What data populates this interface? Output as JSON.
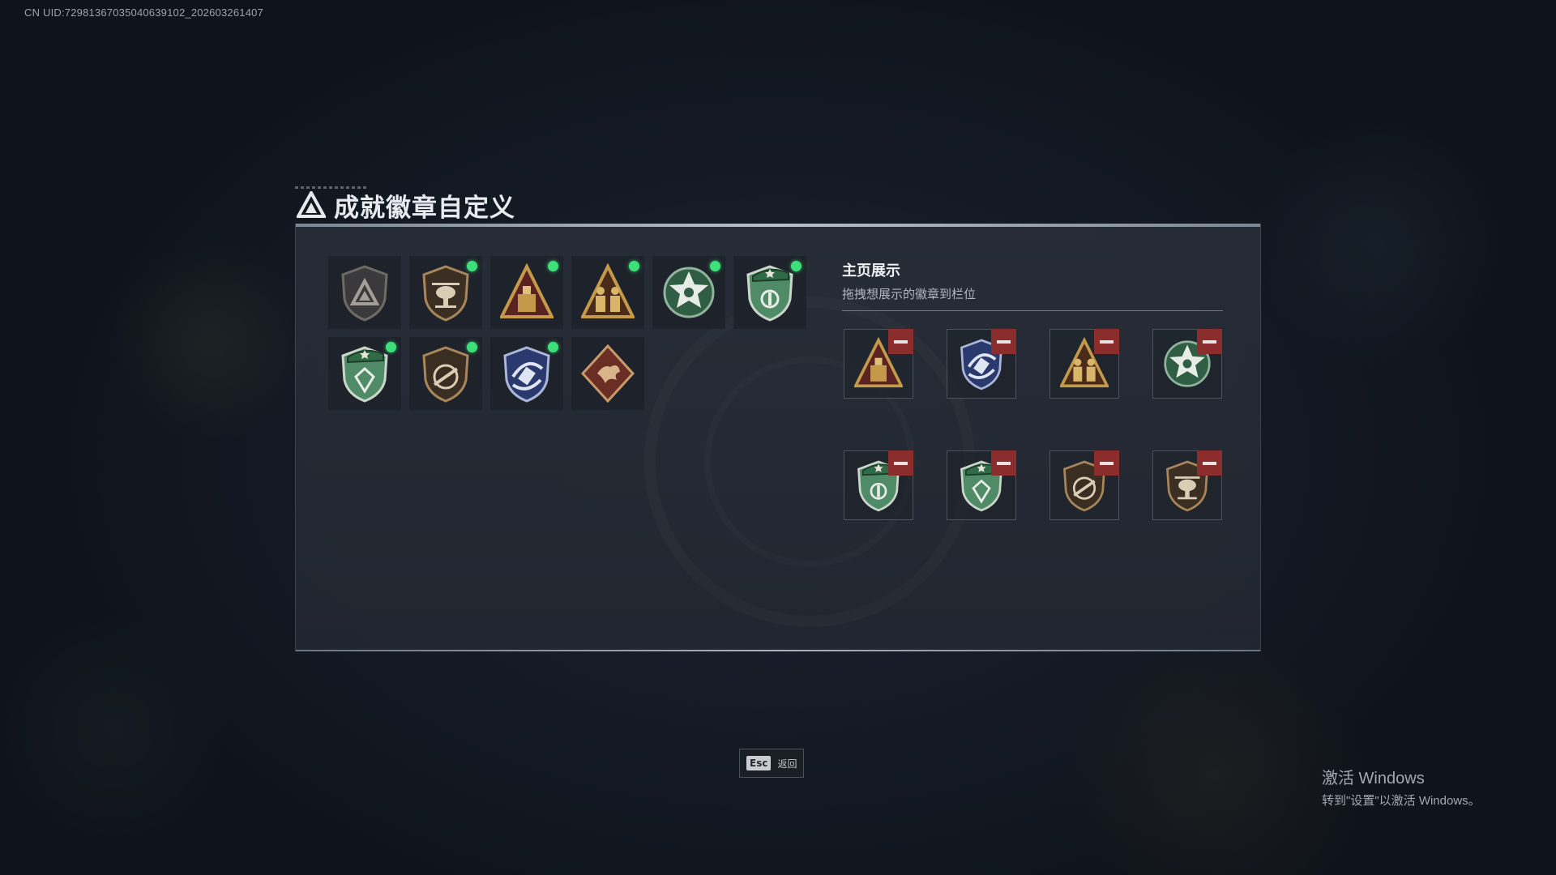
{
  "uid_text": "CN UID:7298136703504063​9102_202603261407",
  "page_title": "成就徽章自定义",
  "display": {
    "title": "主页展示",
    "subtitle": "拖拽想展示的徽章到栏位"
  },
  "badges": [
    {
      "name": "grey-triangle-shield-icon",
      "new": false
    },
    {
      "name": "helicopter-shield-icon",
      "new": true
    },
    {
      "name": "supply-triangle-icon",
      "new": true
    },
    {
      "name": "squad-triangle-icon",
      "new": true
    },
    {
      "name": "green-star-emblem-icon",
      "new": true
    },
    {
      "name": "green-beret-shield-icon",
      "new": true
    },
    {
      "name": "green-beret-gem-shield-icon",
      "new": true
    },
    {
      "name": "rifle-shield-icon",
      "new": true
    },
    {
      "name": "blue-rocket-shield-icon",
      "new": true
    },
    {
      "name": "dragon-diamond-icon",
      "new": false
    }
  ],
  "slots": [
    "supply-triangle-icon",
    "blue-rocket-shield-icon",
    "squad-triangle-icon",
    "green-star-emblem-icon",
    "green-beret-shield-icon",
    "green-beret-gem-shield-icon",
    "rifle-shield-icon",
    "helicopter-shield-icon"
  ],
  "esc": {
    "key": "Esc",
    "label": "返回"
  },
  "activation": {
    "line1": "激活 Windows",
    "line2": "转到\"设置\"以激活 Windows。"
  },
  "colors": {
    "new_dot": "#3ee07a",
    "remove": "#8c2d2d",
    "gold": "#c49a4a",
    "green": "#3f6e52"
  }
}
